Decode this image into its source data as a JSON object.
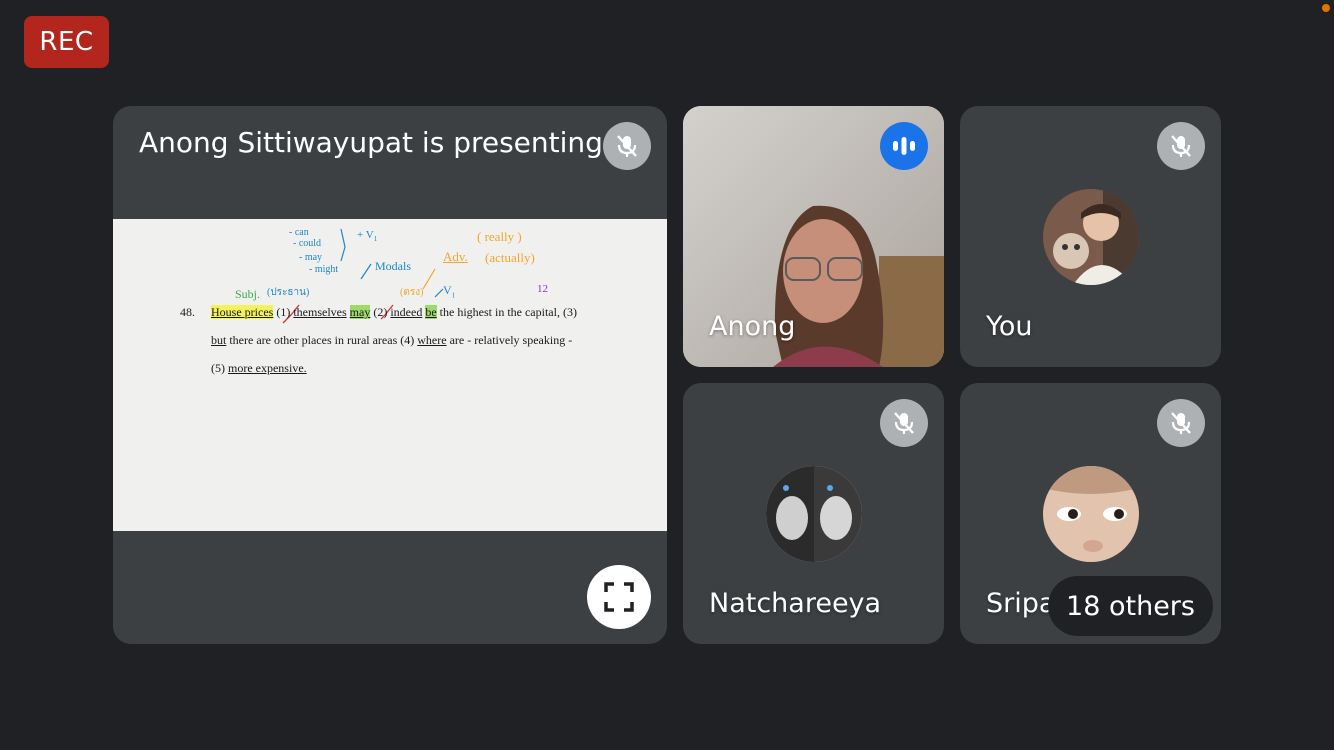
{
  "recording": {
    "label": "REC"
  },
  "presentation": {
    "title": "Anong Sittiwayupat is presenting",
    "slide": {
      "number": "48.",
      "line1": {
        "house_prices": "House prices",
        "m1": "(1)",
        "themselves": "themselves",
        "may": "may",
        "m2": "(2)",
        "indeed": "indeed",
        "be": "be",
        "rest": "the highest in the capital, (3)"
      },
      "line2": {
        "but": "but",
        "middle": "there are other places in rural areas (4)",
        "where": "where",
        "rest": "are - relatively speaking -"
      },
      "line3": {
        "m5": "(5)",
        "more_expensive": "more expensive."
      },
      "annotations": {
        "can": "- can",
        "could": "- could",
        "may": "- may",
        "might": "- might",
        "v1_top": "+ V",
        "modals": "Modals",
        "adv": "Adv.",
        "really": "( really )",
        "actually": "(actually)",
        "subj": "Subj.",
        "subj_thai": "(ประธาน)",
        "thai2": "(ตรง)",
        "v1": "V",
        "purple": "12"
      }
    }
  },
  "participants": [
    {
      "name": "Anong",
      "state": "speaking"
    },
    {
      "name": "You",
      "state": "muted"
    },
    {
      "name": "Natchareeya",
      "state": "muted"
    },
    {
      "name": "Sripa",
      "state": "muted"
    }
  ],
  "others": {
    "label": "18 others"
  },
  "colors": {
    "background": "#202124",
    "tile": "#3c4043",
    "rec": "#b3261e",
    "speaking": "#1a73e8"
  }
}
